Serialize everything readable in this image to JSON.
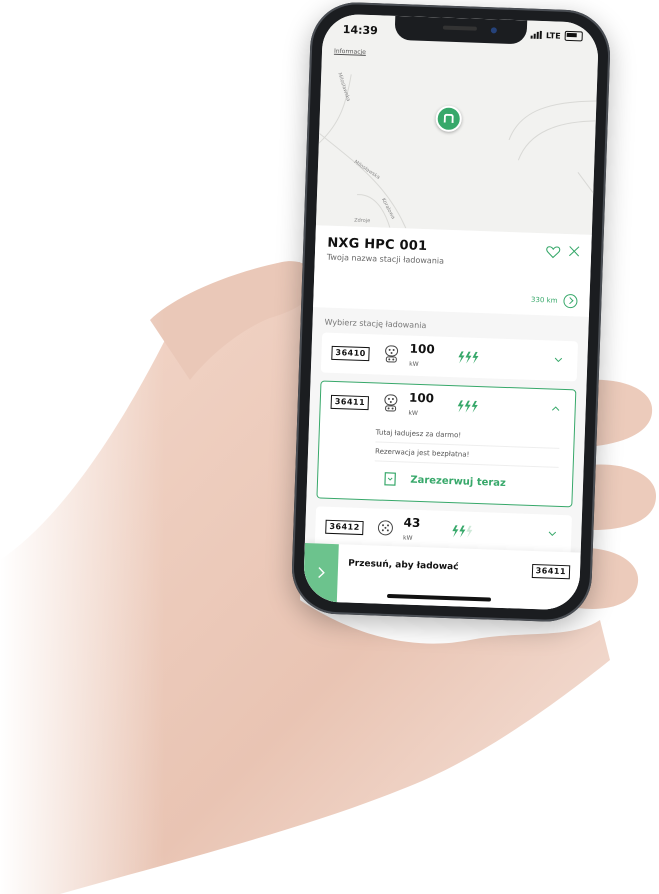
{
  "status": {
    "time": "14:39",
    "network": "LTE"
  },
  "map": {
    "info_link": "Informacje",
    "streets": [
      "Milosławska",
      "Koralowa",
      "Zdroje"
    ]
  },
  "station": {
    "name": "NXG  HPC 001",
    "subtitle": "Twoja nazwa stacji ładowania",
    "distance": "330 km"
  },
  "section_title": "Wybierz stację ładowania",
  "connectors": [
    {
      "id": "36410",
      "power": "100",
      "unit": "kW",
      "speed": "fast"
    },
    {
      "id": "36411",
      "power": "100",
      "unit": "kW",
      "speed": "fast",
      "details": [
        "Tutaj ładujesz za darmo!",
        "Rezerwacja jest bezpłatna!"
      ],
      "reserve_label": "Zarezerwuj teraz"
    },
    {
      "id": "36412",
      "power": "43",
      "unit": "kW",
      "speed": "medium"
    }
  ],
  "swipe": {
    "label": "Przesuń, aby ładować",
    "connector_id": "36411"
  },
  "colors": {
    "accent": "#37a86a",
    "swipe_handle": "#6cc38d"
  }
}
